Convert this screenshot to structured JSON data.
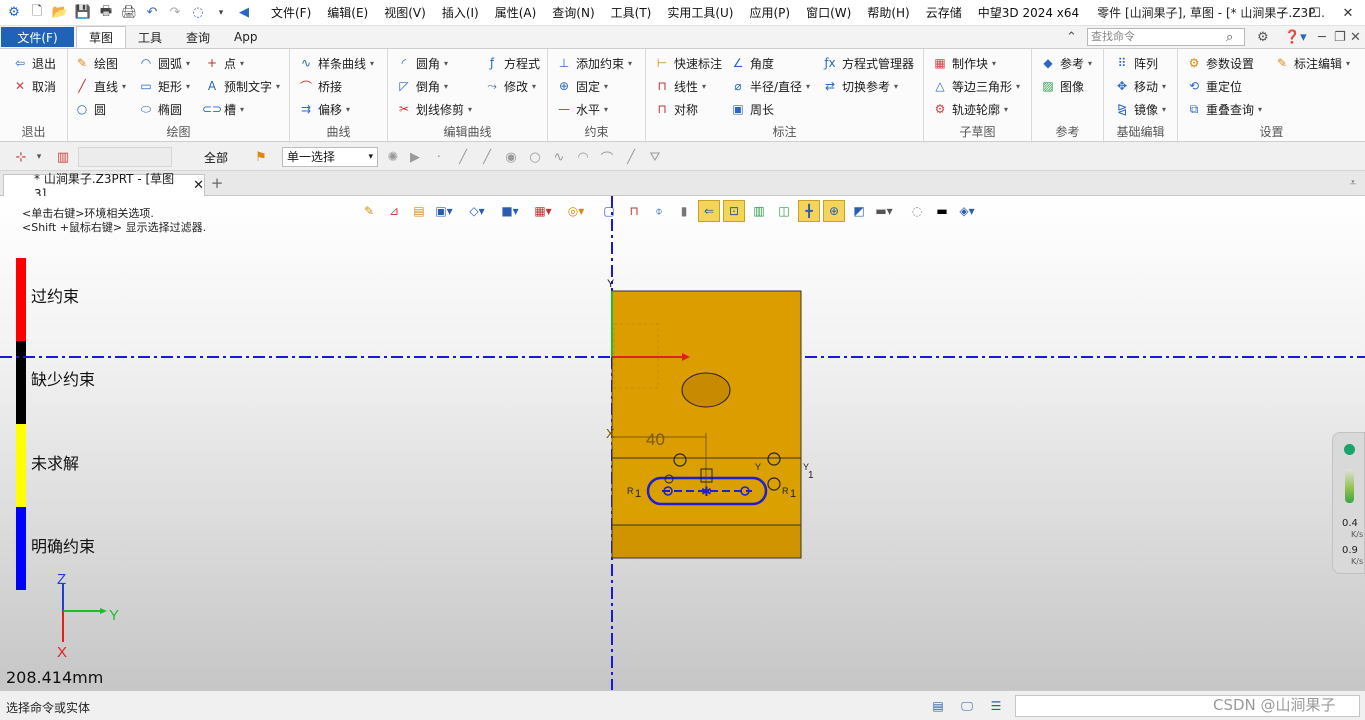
{
  "menu": [
    "文件(F)",
    "编辑(E)",
    "视图(V)",
    "插入(I)",
    "属性(A)",
    "查询(N)",
    "工具(T)",
    "实用工具(U)",
    "应用(P)",
    "窗口(W)",
    "帮助(H)",
    "云存储"
  ],
  "app_version": "中望3D 2024 x64",
  "window_title": "零件 [山涧果子], 草图 - [* 山涧果子.Z3P...",
  "ribbon_tabs": {
    "file": "文件(F)",
    "tabs": [
      "草图",
      "工具",
      "查询",
      "App"
    ],
    "active": "草图"
  },
  "search_placeholder": "查找命令",
  "ribbon": {
    "exit": {
      "label": "退出",
      "items": [
        "退出",
        "取消"
      ]
    },
    "draw": {
      "label": "绘图",
      "items": [
        "绘图",
        "直线",
        "圆",
        "圆弧",
        "矩形",
        "椭圆",
        "点",
        "预制文字",
        "槽"
      ]
    },
    "curve": {
      "label": "曲线",
      "items": [
        "样条曲线",
        "桥接",
        "偏移"
      ]
    },
    "edit_curve": {
      "label": "编辑曲线",
      "items": [
        "圆角",
        "倒角",
        "划线修剪",
        "方程式",
        "修改"
      ]
    },
    "constraint": {
      "label": "约束",
      "items": [
        "添加约束",
        "固定",
        "水平"
      ]
    },
    "dimension": {
      "label": "标注",
      "items": [
        "快速标注",
        "线性",
        "对称",
        "角度",
        "半径/直径",
        "周长",
        "方程式管理器",
        "切换参考"
      ]
    },
    "subsketch": {
      "label": "子草图",
      "items": [
        "制作块",
        "等边三角形",
        "轨迹轮廓"
      ]
    },
    "reference": {
      "label": "参考",
      "items": [
        "参考",
        "图像"
      ]
    },
    "basic_edit": {
      "label": "基础编辑",
      "items": [
        "阵列",
        "移动",
        "镜像"
      ]
    },
    "settings": {
      "label": "设置",
      "items": [
        "参数设置",
        "重定位",
        "重叠查询",
        "标注编辑"
      ]
    }
  },
  "toolbar2": {
    "filter_all": "全部",
    "selection_mode": "单一选择"
  },
  "doc_tab": {
    "label": "* 山涧果子.Z3PRT - [草图3]"
  },
  "viewport": {
    "hint1": "<单击右键>环境相关选项.",
    "hint2": "<Shift +鼠标右键> 显示选择过滤器.",
    "legend": [
      {
        "label": "过约束",
        "color": "#ff0000"
      },
      {
        "label": "缺少约束",
        "color": "#000000"
      },
      {
        "label": "未求解",
        "color": "#ffff00"
      },
      {
        "label": "明确约束",
        "color": "#0000ff"
      }
    ],
    "axis_labels": {
      "z": "Z",
      "y": "Y",
      "x": "X"
    },
    "sketch_axis_labels": {
      "y": "Y",
      "x": "X"
    },
    "dimension_value": "40",
    "radius_label": "R",
    "radius_index": "1",
    "measure": "208.414mm",
    "part_color": "#dc9d00"
  },
  "speed_widget": {
    "value1": "0.4",
    "unit1": "K/s",
    "value2": "0.9",
    "unit2": "K/s"
  },
  "status": {
    "prompt": "选择命令或实体",
    "watermark": "CSDN @山涧果子"
  }
}
